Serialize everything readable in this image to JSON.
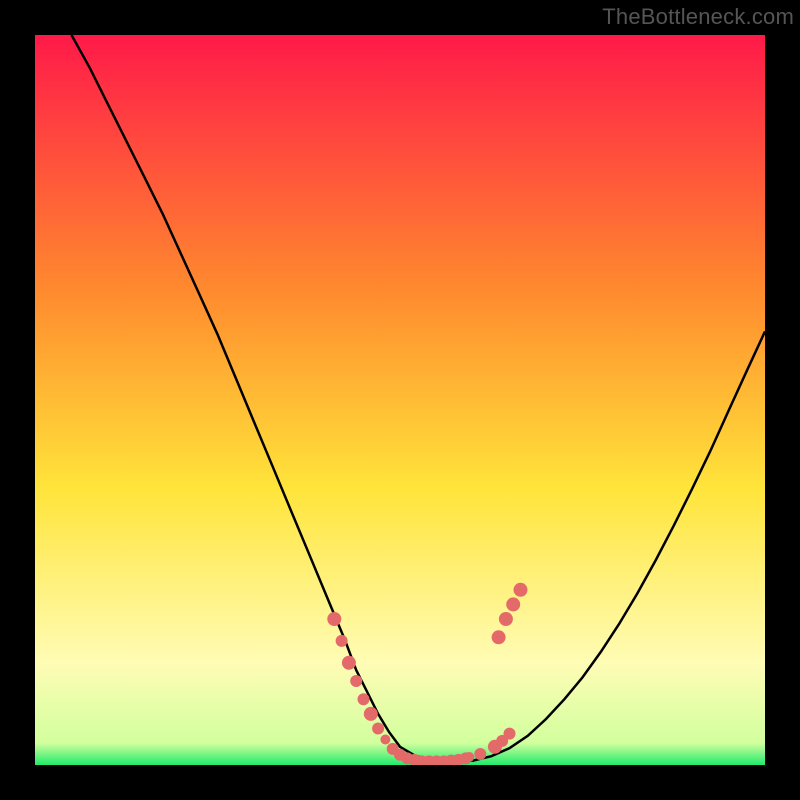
{
  "watermark": "TheBottleneck.com",
  "colors": {
    "frame": "#000000",
    "grad_top": "#ff1a49",
    "grad_mid1": "#ff8a2e",
    "grad_mid2": "#ffe43a",
    "grad_low": "#fffcb5",
    "grad_bottom": "#1feb6a",
    "curve": "#000000",
    "marker_fill": "#e46a6a",
    "marker_stroke": "#c85252"
  },
  "chart_data": {
    "type": "line",
    "title": "",
    "xlabel": "",
    "ylabel": "",
    "xlim": [
      0,
      100
    ],
    "ylim": [
      0,
      100
    ],
    "x": [
      5,
      7.5,
      10,
      12.5,
      15,
      17.5,
      20,
      22.5,
      25,
      27.5,
      30,
      32.5,
      35,
      37.5,
      40,
      42.5,
      44,
      45.5,
      47,
      48.5,
      50,
      52,
      54,
      56,
      58,
      60,
      62.5,
      65,
      67.5,
      70,
      72.5,
      75,
      77.5,
      80,
      82.5,
      85,
      87.5,
      90,
      92.5,
      95,
      97.5,
      100
    ],
    "values": [
      100,
      95.5,
      90.5,
      85.5,
      80.5,
      75.5,
      70,
      64.5,
      59,
      53,
      47,
      41,
      35,
      29,
      23,
      17,
      13,
      10,
      7,
      4.5,
      2.5,
      1.3,
      0.7,
      0.5,
      0.5,
      0.6,
      1.2,
      2.3,
      4,
      6.3,
      9,
      12,
      15.5,
      19.3,
      23.5,
      28,
      32.8,
      37.8,
      43,
      48.5,
      54,
      59.4
    ],
    "markers": [
      {
        "x": 41,
        "y": 20,
        "r": 7
      },
      {
        "x": 42,
        "y": 17,
        "r": 6
      },
      {
        "x": 43,
        "y": 14,
        "r": 7
      },
      {
        "x": 44,
        "y": 11.5,
        "r": 6
      },
      {
        "x": 45,
        "y": 9,
        "r": 6
      },
      {
        "x": 46,
        "y": 7,
        "r": 7
      },
      {
        "x": 47,
        "y": 5,
        "r": 6
      },
      {
        "x": 48,
        "y": 3.5,
        "r": 5
      },
      {
        "x": 49,
        "y": 2.2,
        "r": 6
      },
      {
        "x": 50,
        "y": 1.4,
        "r": 6
      },
      {
        "x": 51,
        "y": 0.9,
        "r": 6
      },
      {
        "x": 52,
        "y": 0.7,
        "r": 6
      },
      {
        "x": 53,
        "y": 0.5,
        "r": 6
      },
      {
        "x": 54,
        "y": 0.5,
        "r": 6
      },
      {
        "x": 55,
        "y": 0.5,
        "r": 6
      },
      {
        "x": 56,
        "y": 0.5,
        "r": 6
      },
      {
        "x": 57,
        "y": 0.6,
        "r": 6
      },
      {
        "x": 58,
        "y": 0.7,
        "r": 6
      },
      {
        "x": 59,
        "y": 0.9,
        "r": 6
      },
      {
        "x": 59.5,
        "y": 1.1,
        "r": 5
      },
      {
        "x": 61,
        "y": 1.5,
        "r": 6
      },
      {
        "x": 63,
        "y": 2.5,
        "r": 7
      },
      {
        "x": 64,
        "y": 3.3,
        "r": 6
      },
      {
        "x": 65,
        "y": 4.3,
        "r": 6
      },
      {
        "x": 63.5,
        "y": 17.5,
        "r": 7
      },
      {
        "x": 64.5,
        "y": 20,
        "r": 7
      },
      {
        "x": 65.5,
        "y": 22,
        "r": 7
      },
      {
        "x": 66.5,
        "y": 24,
        "r": 7
      }
    ]
  }
}
